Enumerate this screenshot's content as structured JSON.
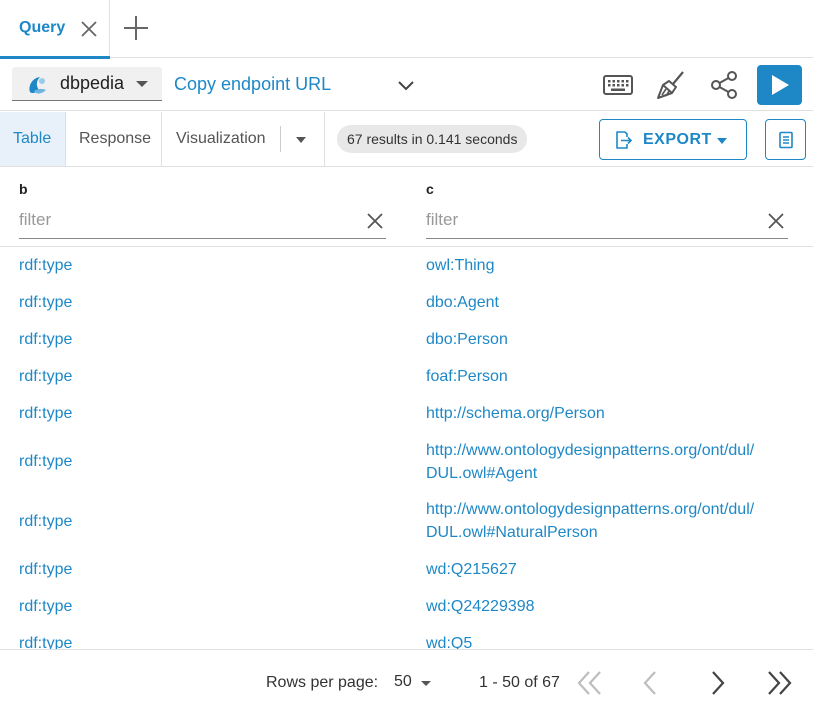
{
  "tabs": [
    {
      "label": "Query",
      "active": true
    }
  ],
  "toolbar": {
    "endpoint": "dbpedia",
    "copy_endpoint_label": "Copy endpoint URL"
  },
  "results": {
    "view_tabs": [
      "Table",
      "Response",
      "Visualization"
    ],
    "active_view": "Table",
    "summary": "67 results in 0.141 seconds",
    "export_label": "EXPORT"
  },
  "table": {
    "columns": [
      {
        "name": "b",
        "filter_placeholder": "filter"
      },
      {
        "name": "c",
        "filter_placeholder": "filter"
      }
    ],
    "rows": [
      [
        "rdf:type",
        "owl:Thing"
      ],
      [
        "rdf:type",
        "dbo:Agent"
      ],
      [
        "rdf:type",
        "dbo:Person"
      ],
      [
        "rdf:type",
        "foaf:Person"
      ],
      [
        "rdf:type",
        "http://schema.org/Person"
      ],
      [
        "rdf:type",
        "http://www.ontologydesignpatterns.org/ont/dul/ DUL.owl#Agent"
      ],
      [
        "rdf:type",
        "http://www.ontologydesignpatterns.org/ont/dul/ DUL.owl#NaturalPerson"
      ],
      [
        "rdf:type",
        "wd:Q215627"
      ],
      [
        "rdf:type",
        "wd:Q24229398"
      ],
      [
        "rdf:type",
        "wd:Q5"
      ]
    ]
  },
  "pagination": {
    "rows_per_page_label": "Rows per page:",
    "rows_per_page": "50",
    "range": "1 - 50 of 67"
  },
  "colors": {
    "accent": "#1e88c7",
    "active_tab_bg": "#e8f1fa",
    "chip_bg": "#e8e8e8"
  }
}
